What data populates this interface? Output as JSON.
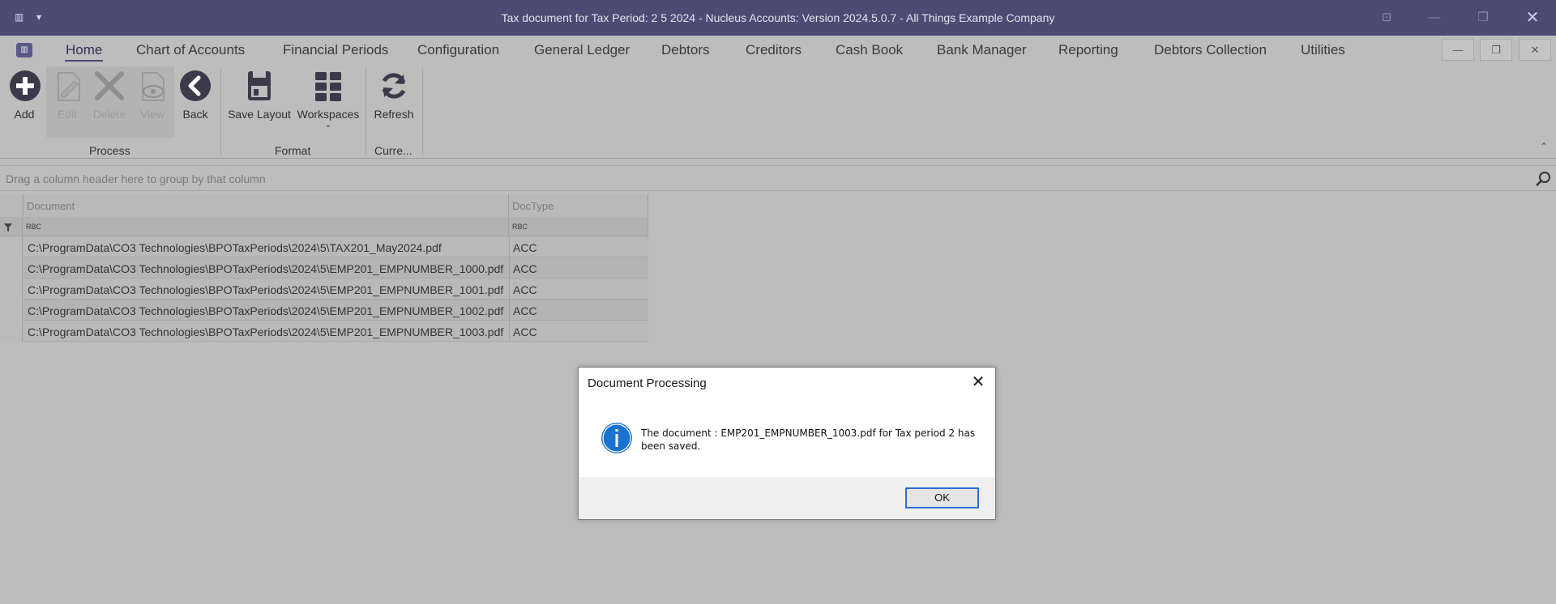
{
  "window": {
    "title": "Tax document for Tax Period: 2 5 2024 - Nucleus Accounts: Version 2024.5.0.7 - All Things Example Company"
  },
  "menu": {
    "items": [
      "Home",
      "Chart of Accounts",
      "Financial Periods",
      "Configuration",
      "General Ledger",
      "Debtors",
      "Creditors",
      "Cash Book",
      "Bank Manager",
      "Reporting",
      "Debtors Collection",
      "Utilities"
    ]
  },
  "ribbon": {
    "buttons": {
      "add": "Add",
      "edit": "Edit",
      "delete": "Delete",
      "view": "View",
      "back": "Back",
      "save_layout": "Save Layout",
      "workspaces": "Workspaces",
      "refresh": "Refresh"
    },
    "groups": {
      "process": "Process",
      "format": "Format",
      "current": "Curre..."
    }
  },
  "grid": {
    "group_panel_text": "Drag a column header here to group by that column",
    "columns": [
      "Document",
      "DocType"
    ],
    "filter_icon_text": "RBC",
    "rows": [
      {
        "document": "C:\\ProgramData\\CO3 Technologies\\BPOTaxPeriods\\2024\\5\\TAX201_May2024.pdf",
        "doctype": "ACC"
      },
      {
        "document": "C:\\ProgramData\\CO3 Technologies\\BPOTaxPeriods\\2024\\5\\EMP201_EMPNUMBER_1000.pdf",
        "doctype": "ACC"
      },
      {
        "document": "C:\\ProgramData\\CO3 Technologies\\BPOTaxPeriods\\2024\\5\\EMP201_EMPNUMBER_1001.pdf",
        "doctype": "ACC"
      },
      {
        "document": "C:\\ProgramData\\CO3 Technologies\\BPOTaxPeriods\\2024\\5\\EMP201_EMPNUMBER_1002.pdf",
        "doctype": "ACC"
      },
      {
        "document": "C:\\ProgramData\\CO3 Technologies\\BPOTaxPeriods\\2024\\5\\EMP201_EMPNUMBER_1003.pdf",
        "doctype": "ACC"
      }
    ]
  },
  "dialog": {
    "title": "Document Processing",
    "message": "The document : EMP201_EMPNUMBER_1003.pdf for Tax period 2 has been saved.",
    "ok_label": "OK",
    "icon": "info-icon"
  },
  "colors": {
    "titlebar": "#4d4a74",
    "overlay_bg": "#bdbdbd",
    "dialog_bg": "#ffffff",
    "info_blue": "#1a73d1",
    "ok_border": "#2a6fd6"
  }
}
